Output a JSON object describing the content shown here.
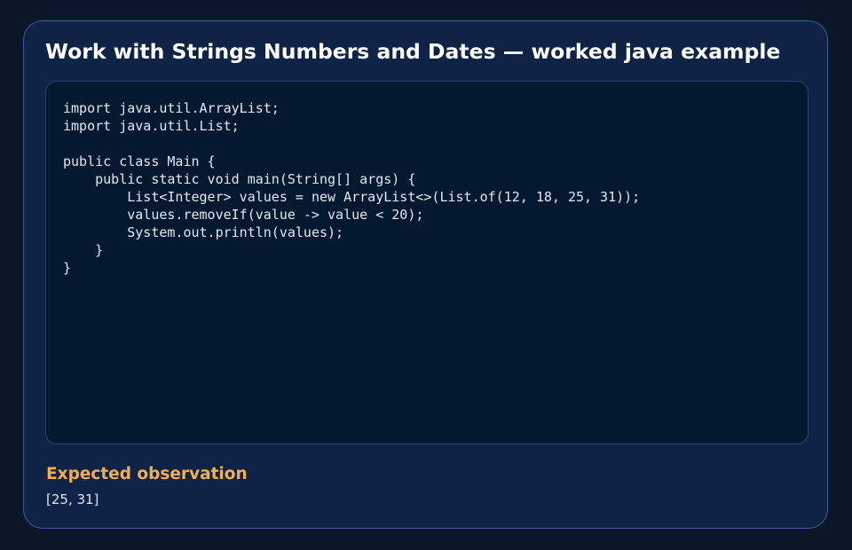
{
  "card": {
    "title": "Work with Strings Numbers and Dates — worked java example"
  },
  "code": {
    "language": "java",
    "lines": [
      "import java.util.ArrayList;",
      "import java.util.List;",
      "",
      "public class Main {",
      "    public static void main(String[] args) {",
      "        List<Integer> values = new ArrayList<>(List.of(12, 18, 25, 31));",
      "        values.removeIf(value -> value < 20);",
      "        System.out.println(values);",
      "    }",
      "}"
    ]
  },
  "observation": {
    "heading": "Expected observation",
    "value": "[25, 31]"
  },
  "colors": {
    "page_background": "#0b1628",
    "card_background": "#0e2346",
    "card_border": "#3d5f94",
    "code_background": "#041930",
    "heading_accent": "#f0ae55"
  }
}
